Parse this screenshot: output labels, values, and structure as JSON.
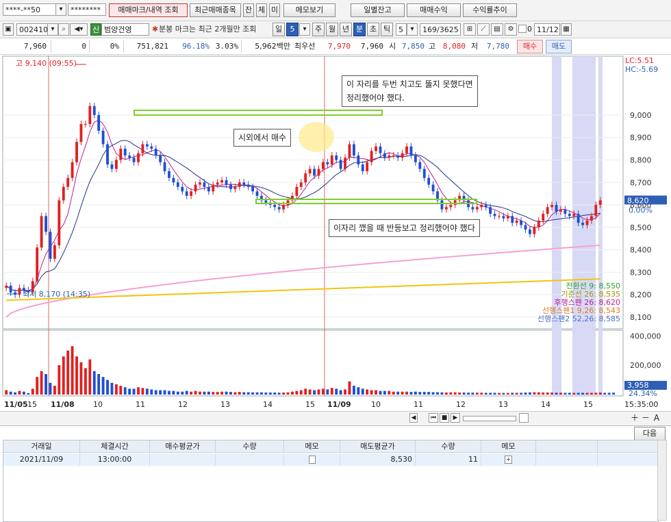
{
  "toolbar1": {
    "account": "****-**50",
    "password": "********",
    "buttons": [
      "매매마크/내역 조회",
      "최근매매종목",
      "잔",
      "체",
      "미",
      "메모보기",
      "일별잔고",
      "매매수익",
      "수익률추이"
    ]
  },
  "toolbar2": {
    "code": "002410",
    "badge": "신",
    "name": "범양건영",
    "notice": "분봉 마크는 최근 2개월만 조회",
    "periods": [
      "일",
      "5",
      "주",
      "월",
      "년",
      "분",
      "초",
      "틱"
    ],
    "selected_period": "분",
    "interval": "5",
    "count": "169/3625",
    "zero": "0",
    "date": "11/12"
  },
  "quote": {
    "price": "7,960",
    "change": "0",
    "rate": "0%",
    "volume": "751,821",
    "strength": "96.18%",
    "turnover_rate": "3.03%",
    "amount": "5,962백만",
    "bid_label": "최우선",
    "bid": "7,970",
    "ask": "7,960",
    "open_label": "시",
    "open": "7,850",
    "high_label": "고",
    "high": "8,080",
    "low_label": "저",
    "low": "7,780",
    "buy_btn": "매수",
    "sell_btn": "매도"
  },
  "chart_data": {
    "type": "candlestick",
    "high_label": "고 9,140 (09:55)",
    "low_label": "최저 8,170 (14:35)",
    "lc": "LC:5.51",
    "hc": "HC:-5.69",
    "price_axis": [
      "9,000",
      "8,900",
      "8,800",
      "8,700",
      "8,600",
      "8,500",
      "8,400",
      "8,300",
      "8,200",
      "8,100"
    ],
    "price_range": [
      8060,
      9250
    ],
    "current_price": "8,620",
    "current_rate": "0.00%",
    "volume_axis": [
      "400,000",
      "200,000"
    ],
    "volume_current": "3,958",
    "volume_rate": "24.34%",
    "x_labels": [
      "11/05",
      "15",
      "11/08",
      "10",
      "11",
      "12",
      "13",
      "14",
      "15",
      "11/09",
      "10",
      "11",
      "12",
      "13",
      "14",
      "15"
    ],
    "time_label": "15:35:00",
    "indicators": [
      {
        "label": "전환선 9: 8,550",
        "color": "#2e9e2e"
      },
      {
        "label": "기준선 26: 8,535",
        "color": "#9a9a00"
      },
      {
        "label": "후행스팬 26: 8,620",
        "color": "#c0198f"
      },
      {
        "label": "선행스팬1 9,26: 8,543",
        "color": "#e07a1f"
      },
      {
        "label": "선행스팬2 52,26: 8,585",
        "color": "#4a6fd1"
      }
    ],
    "annotations": [
      "이 자리를 두번 치고도 뚫지 못했다면",
      "정리했어야 했다.",
      "시외에서 매수",
      "이자리 깼을 때 반등보고 정리했어야 했다"
    ],
    "series": [
      {
        "name": "price",
        "values": [
          8240,
          8210,
          8200,
          8230,
          8220,
          8210,
          8260,
          8410,
          8550,
          8480,
          8360,
          8420,
          8620,
          8680,
          8720,
          8790,
          8880,
          8960,
          8960,
          9040,
          9000,
          8930,
          8870,
          8780,
          8760,
          8800,
          8850,
          8820,
          8810,
          8790,
          8830,
          8870,
          8860,
          8850,
          8820,
          8790,
          8750,
          8720,
          8700,
          8680,
          8660,
          8640,
          8660,
          8690,
          8700,
          8680,
          8660,
          8690,
          8700,
          8710,
          8690,
          8670,
          8680,
          8700,
          8690,
          8680,
          8660,
          8640,
          8620,
          8610,
          8600,
          8590,
          8580,
          8600,
          8620,
          8640,
          8680,
          8700,
          8740,
          8760,
          8730,
          8760,
          8790,
          8780,
          8820,
          8800,
          8760,
          8810,
          8870,
          8820,
          8780,
          8750,
          8790,
          8840,
          8860,
          8830,
          8810,
          8820,
          8820,
          8810,
          8830,
          8860,
          8820,
          8790,
          8760,
          8720,
          8690,
          8660,
          8620,
          8580,
          8590,
          8600,
          8620,
          8640,
          8620,
          8590,
          8580,
          8590,
          8600,
          8590,
          8560,
          8550,
          8550,
          8540,
          8550,
          8520,
          8530,
          8510,
          8490,
          8470,
          8500,
          8530,
          8560,
          8590,
          8600,
          8570,
          8580,
          8560,
          8550,
          8560,
          8520,
          8510,
          8530,
          8550,
          8600,
          8620
        ]
      },
      {
        "name": "volume",
        "values": [
          30,
          20,
          15,
          25,
          20,
          10,
          40,
          120,
          160,
          140,
          80,
          60,
          200,
          260,
          300,
          330,
          260,
          220,
          180,
          240,
          160,
          140,
          120,
          100,
          80,
          70,
          60,
          50,
          40,
          40,
          50,
          45,
          40,
          35,
          30,
          30,
          30,
          25,
          25,
          20,
          20,
          25,
          20,
          25,
          20,
          20,
          20,
          18,
          18,
          20,
          20,
          18,
          16,
          18,
          16,
          16,
          15,
          15,
          15,
          14,
          14,
          14,
          13,
          14,
          15,
          20,
          25,
          30,
          40,
          35,
          30,
          35,
          40,
          35,
          45,
          40,
          30,
          35,
          90,
          60,
          50,
          40,
          35,
          30,
          30,
          25,
          25,
          25,
          20,
          20,
          20,
          20,
          18,
          20,
          18,
          18,
          18,
          16,
          16,
          15,
          14,
          15,
          15,
          14,
          14,
          13,
          13,
          13,
          13,
          12,
          12,
          12,
          11,
          11,
          11,
          12,
          12,
          12,
          14,
          15,
          16,
          15,
          14,
          14,
          14,
          13,
          13,
          12,
          12,
          12,
          12,
          12,
          12,
          12,
          13,
          14,
          12,
          12,
          13
        ]
      }
    ]
  },
  "nav": {
    "buttons": [
      "◀",
      "⏮",
      "■",
      "▶",
      "＋",
      "－",
      "A"
    ]
  },
  "panel": {
    "next_button": "다음",
    "headers": [
      "거래일",
      "체결시간",
      "매수평균가",
      "수량",
      "메모",
      "매도평균가",
      "수량",
      "메모"
    ],
    "row": [
      "2021/11/09",
      "13:00:00",
      "",
      "",
      "",
      "8,530",
      "11",
      ""
    ]
  }
}
